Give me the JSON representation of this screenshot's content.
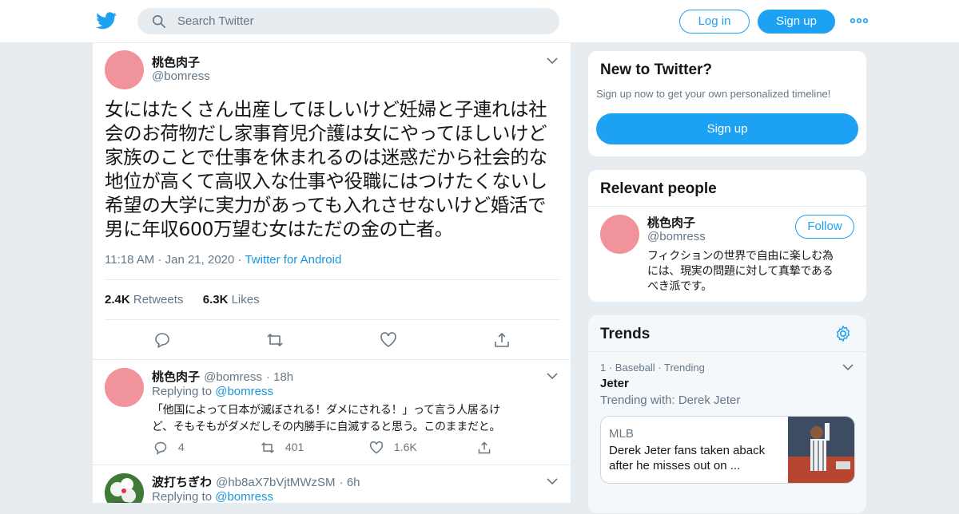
{
  "header": {
    "search_placeholder": "Search Twitter",
    "login_label": "Log in",
    "signup_label": "Sign up"
  },
  "tweet": {
    "display_name": "桃色肉子",
    "handle": "@bomress",
    "text_lines": [
      "女にはたくさん出産してほしいけど妊婦と子連れは社",
      "会のお荷物だし家事育児介護は女にやってほしいけど",
      "家族のことで仕事を休まれるのは迷惑だから社会的な",
      "地位が高くて高収入な仕事や役職にはつけたくないし",
      "希望の大学に実力があっても入れさせないけど婚活で",
      "男に年収600万望む女はただの金の亡者。"
    ],
    "time": "11:18 AM",
    "date": "Jan 21, 2020",
    "source": "Twitter for Android",
    "retweets_count": "2.4K",
    "retweets_label": "Retweets",
    "likes_count": "6.3K",
    "likes_label": "Likes"
  },
  "replies": [
    {
      "display_name": "桃色肉子",
      "handle": "@bomress",
      "age": "18h",
      "replying_prefix": "Replying to",
      "replying_to": "@bomress",
      "text_lines": [
        "「他国によって日本が滅ぼされる！ダメにされる！」って言う人居るけ",
        "ど、そもそもがダメだしその内勝手に自滅すると思う。このままだと。"
      ],
      "reply_count": "4",
      "retweet_count": "401",
      "like_count": "1.6K"
    },
    {
      "display_name": "波打ちぎわ",
      "handle": "@hb8aX7bVjtMWzSM",
      "age": "6h",
      "replying_prefix": "Replying to",
      "replying_to": "@bomress"
    }
  ],
  "new_to_twitter": {
    "title": "New to Twitter?",
    "subtitle": "Sign up now to get your own personalized timeline!",
    "button": "Sign up"
  },
  "relevant_people": {
    "title": "Relevant people",
    "display_name": "桃色肉子",
    "handle": "@bomress",
    "follow_label": "Follow",
    "bio_lines": [
      "フィクションの世界で自由に楽しむ為",
      "には、現実の問題に対して真摯である",
      "べき派です。"
    ]
  },
  "trends": {
    "title": "Trends",
    "item": {
      "rank": "1",
      "category": "Baseball",
      "status": "Trending",
      "name": "Jeter",
      "trending_with": "Trending with: Derek Jeter"
    },
    "news": {
      "source": "MLB",
      "headline_lines": [
        "Derek Jeter fans taken aback",
        "after he misses out on ..."
      ]
    }
  },
  "colors": {
    "accent": "#1da1f2",
    "link": "#1b95e0",
    "avatar_pink": "#f0939a",
    "muted": "#657786",
    "border": "#e6ecf0"
  },
  "icons": [
    "twitter-bird-icon",
    "search-icon",
    "more-dots-icon",
    "chevron-down-icon",
    "reply-icon",
    "retweet-icon",
    "like-icon",
    "share-icon",
    "settings-gear-icon"
  ]
}
